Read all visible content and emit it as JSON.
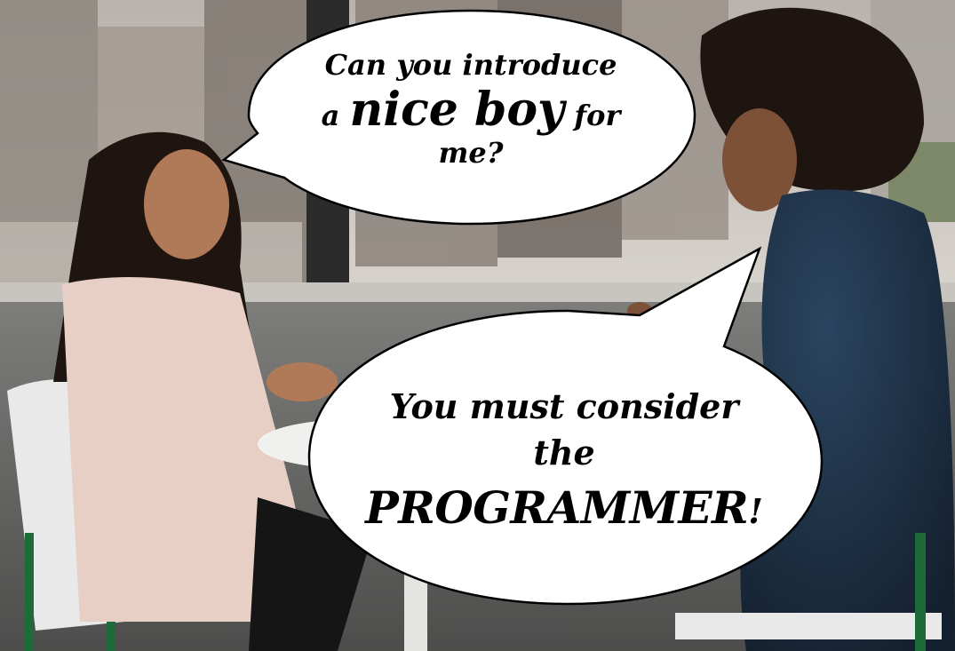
{
  "bubbles": {
    "top": {
      "line1": "Can you introduce",
      "line2_pre": "a",
      "line2_emph": "nice boy",
      "line2_post": "for",
      "line3": "me?"
    },
    "bottom": {
      "line1": "You must consider",
      "line2": "the",
      "line3_emph": "PROGRAMMER",
      "line3_post": "!"
    }
  },
  "palette": {
    "window_light": "#c9c4bd",
    "frame_dark": "#2b2b2b",
    "wall": "#6b6b6b",
    "blouse": "#e7cfc6",
    "navy_top": "#1d2f44",
    "skin": "#9b6a4f",
    "hair": "#1e1410",
    "chair": "#e9e9e9",
    "chair_leg": "#1e6b3a"
  }
}
